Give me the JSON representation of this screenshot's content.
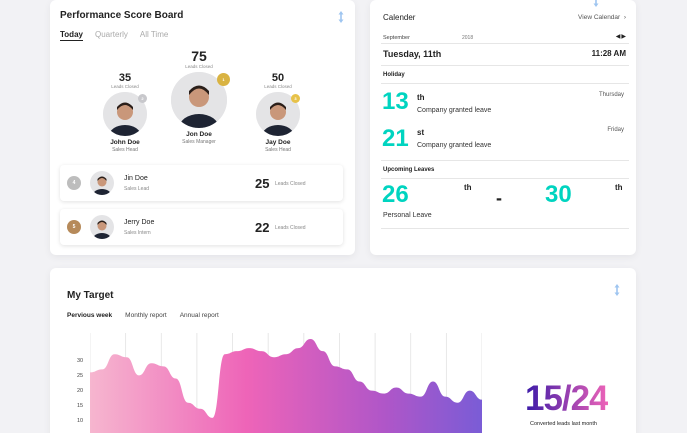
{
  "performance": {
    "title": "Performance Score Board",
    "tabs": [
      "Today",
      "Quarterly",
      "All Time"
    ],
    "active_tab": "Today",
    "podium": [
      {
        "score": "35",
        "score_label": "Leads Closed",
        "name": "John Doe",
        "role": "Sales Head",
        "rank": "2",
        "medal_color": "#c8c8cc"
      },
      {
        "score": "75",
        "score_label": "Leads Closed",
        "name": "Jon Doe",
        "role": "Sales Manager",
        "rank": "1",
        "medal_color": "#d9b342"
      },
      {
        "score": "50",
        "score_label": "Leads Closed",
        "name": "Jay Doe",
        "role": "Sales Head",
        "rank": "3",
        "medal_color": "#e7c24a"
      }
    ],
    "rows": [
      {
        "rank": "4",
        "name": "Jin Doe",
        "role": "Sales Lead",
        "score": "25",
        "score_label": "Leads Closed",
        "badge_color": "#bdbdbd"
      },
      {
        "rank": "5",
        "name": "Jerry Doe",
        "role": "Sales Intern",
        "score": "22",
        "score_label": "Leads Closed",
        "badge_color": "#b68a5a"
      }
    ]
  },
  "calendar": {
    "title": "Calender",
    "view_link": "View Calendar",
    "month": "September",
    "year": "2018",
    "date": "Tuesday, 11th",
    "time": "11:28 AM",
    "holiday_label": "Holiday",
    "holidays": [
      {
        "day": "13",
        "suffix": "th",
        "weekday": "Thursday",
        "text": "Company granted leave"
      },
      {
        "day": "21",
        "suffix": "st",
        "weekday": "Friday",
        "text": "Company granted leave"
      }
    ],
    "upcoming_label": "Upcoming Leaves",
    "upcoming": {
      "from_day": "26",
      "from_suffix": "th",
      "separator": "-",
      "to_day": "30",
      "to_suffix": "th",
      "text": "Personal Leave"
    },
    "accent_color": "#00d4c0"
  },
  "target": {
    "title": "My Target",
    "tabs": [
      "Pervious week",
      "Monthly report",
      "Annual report"
    ],
    "active_tab": "Pervious week",
    "ratio_text": "15/24",
    "ratio_label": "Converted leads last month"
  },
  "chart_data": {
    "type": "area",
    "title": "",
    "ylabel": "",
    "xlabel": "",
    "y_ticks": [
      "30",
      "25",
      "20",
      "15",
      "10"
    ],
    "ylim": [
      0,
      33
    ],
    "x": [
      0,
      1,
      2,
      3,
      4,
      5,
      6,
      7,
      8,
      9,
      10,
      11,
      12,
      13,
      14,
      15,
      16,
      17,
      18,
      19,
      20,
      21,
      22,
      23,
      24,
      25,
      26,
      27,
      28,
      29,
      30,
      31,
      32
    ],
    "values": [
      20,
      21,
      26,
      25,
      19,
      23,
      22,
      18,
      10,
      8,
      5,
      26,
      27,
      28,
      27,
      25,
      26,
      28,
      31,
      27,
      22,
      21,
      17,
      14,
      13,
      15,
      13,
      12,
      17,
      12,
      10,
      14,
      11
    ],
    "gradient_colors": [
      "#f6b6cf",
      "#ee64b8",
      "#b056c8",
      "#7a5cd6"
    ]
  }
}
